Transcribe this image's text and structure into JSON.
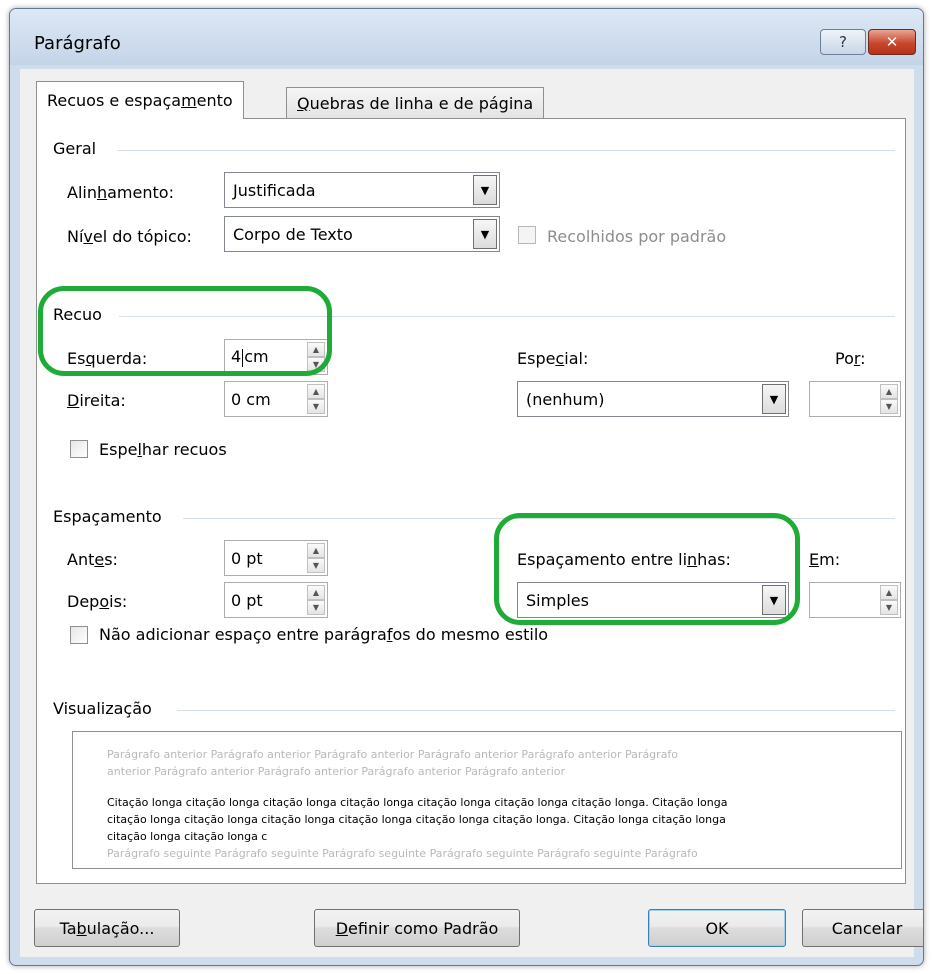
{
  "window": {
    "title": "Parágrafo",
    "help_label": "?",
    "close_label": "✕"
  },
  "tabs": {
    "active": {
      "pre": "Recuos e espaça",
      "acc": "m",
      "post": "ento"
    },
    "inactive": {
      "pre": "",
      "acc": "Q",
      "post": "uebras de linha e de página"
    }
  },
  "geral": {
    "title": "Geral",
    "alinhamento_label": {
      "pre": "Alin",
      "acc": "h",
      "post": "amento:"
    },
    "alinhamento_value": "Justificada",
    "nivel_label": {
      "pre": "Ní",
      "acc": "v",
      "post": "el do tópico:"
    },
    "nivel_value": "Corpo de Texto",
    "recolhidos_label": "Recolhidos por padrão"
  },
  "recuo": {
    "title": "Recuo",
    "esquerda_label": {
      "pre": "Es",
      "acc": "q",
      "post": "uerda:"
    },
    "esquerda_value_a": "4",
    "esquerda_value_b": "cm",
    "direita_label": {
      "pre": "",
      "acc": "D",
      "post": "ireita:"
    },
    "direita_value": "0 cm",
    "especial_label": {
      "pre": "Espe",
      "acc": "c",
      "post": "ial:"
    },
    "especial_value": "(nenhum)",
    "por_label": {
      "pre": "Po",
      "acc": "r",
      "post": ":"
    },
    "por_value": "",
    "espelhar_label": {
      "pre": "Espe",
      "acc": "l",
      "post": "har recuos"
    }
  },
  "espacamento": {
    "title": "Espaçamento",
    "antes_label": {
      "pre": "Ant",
      "acc": "e",
      "post": "s:"
    },
    "antes_value": "0 pt",
    "depois_label": {
      "pre": "Dep",
      "acc": "o",
      "post": "is:"
    },
    "depois_value": "0 pt",
    "entre_linhas_label": {
      "pre": "Espaçamento entre li",
      "acc": "n",
      "post": "has:"
    },
    "entre_linhas_value": "Simples",
    "em_label": {
      "pre": "",
      "acc": "E",
      "post": "m:"
    },
    "em_value": "",
    "nao_adicionar_label": {
      "pre": "Não adicionar espaço entre parágra",
      "acc": "f",
      "post": "os do mesmo estilo"
    }
  },
  "visualizacao": {
    "title": "Visualização",
    "prev_line1": "Parágrafo anterior Parágrafo anterior Parágrafo anterior Parágrafo anterior Parágrafo anterior Parágrafo",
    "prev_line2": "anterior Parágrafo anterior Parágrafo anterior Parágrafo anterior Parágrafo anterior",
    "cur_line1": "Citação longa citação longa citação longa citação longa citação longa citação longa citação longa. Citação longa",
    "cur_line2": "citação longa citação longa citação longa citação longa citação longa citação longa. Citação longa citação longa",
    "cur_line3": "citação longa citação longa c",
    "next_line1": "Parágrafo seguinte Parágrafo seguinte Parágrafo seguinte Parágrafo seguinte Parágrafo seguinte Parágrafo"
  },
  "buttons": {
    "tabulacao": {
      "pre": "Ta",
      "acc": "b",
      "post": "ulação..."
    },
    "definir": {
      "pre": "",
      "acc": "D",
      "post": "efinir como Padrão"
    },
    "ok": "OK",
    "cancelar": "Cancelar"
  },
  "colors": {
    "highlight": "#1eac36",
    "titlebar": "#cfdcec",
    "close": "#c7482d"
  },
  "icons": {
    "dropdown": "▼",
    "spin_up": "▲",
    "spin_down": "▼"
  }
}
